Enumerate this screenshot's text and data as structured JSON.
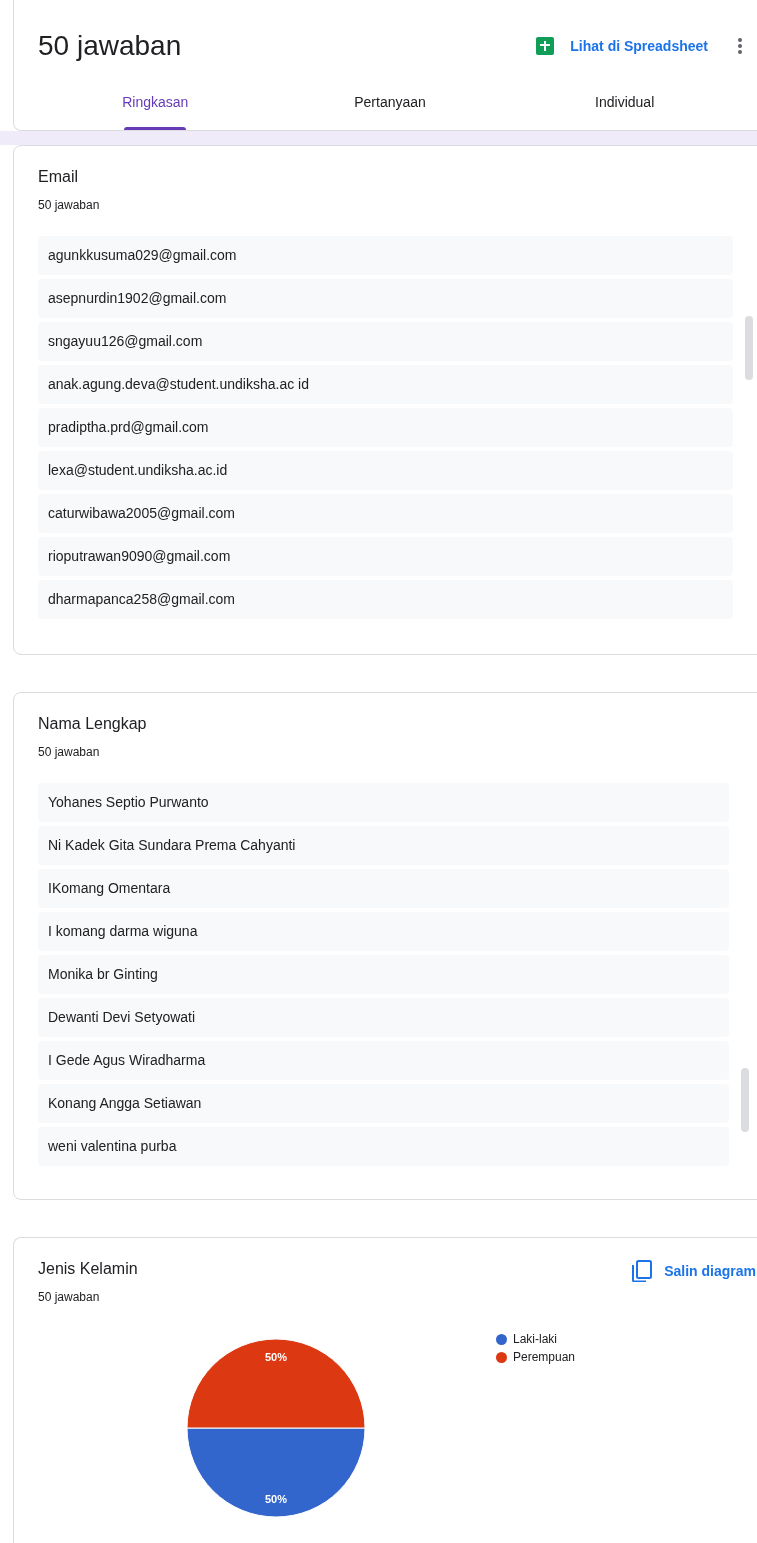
{
  "header": {
    "title": "50 jawaban",
    "sheet_link": "Lihat di Spreadsheet"
  },
  "tabs": [
    {
      "label": "Ringkasan",
      "selected": true
    },
    {
      "label": "Pertanyaan",
      "selected": false
    },
    {
      "label": "Individual",
      "selected": false
    }
  ],
  "questions": [
    {
      "kind": "list",
      "title": "Email",
      "count": "50 jawaban",
      "answers": [
        "agunkkusuma029@gmail.com",
        "asepnurdin1902@gmail.com",
        "sngayuu126@gmail.com",
        "anak.agung.deva@student.undiksha.ac id",
        "pradiptha.prd@gmail.com",
        "lexa@student.undiksha.ac.id",
        "caturwibawa2005@gmail.com",
        "rioputrawan9090@gmail.com",
        "dharmapanca258@gmail.com"
      ]
    },
    {
      "kind": "list",
      "title": "Nama Lengkap",
      "count": "50 jawaban",
      "answers": [
        "Yohanes Septio Purwanto",
        "Ni Kadek Gita Sundara Prema Cahyanti",
        "IKomang Omentara",
        "I komang darma wiguna",
        "Monika br Ginting",
        "Dewanti Devi Setyowati",
        "I Gede Agus Wiradharma",
        "Konang Angga Setiawan",
        "weni valentina purba"
      ]
    },
    {
      "kind": "pie",
      "title": "Jenis Kelamin",
      "count": "50 jawaban",
      "copy_label": "Salin diagram",
      "chart_data": {
        "type": "pie",
        "categories": [
          "Laki-laki",
          "Perempuan"
        ],
        "values": [
          50,
          50
        ],
        "value_labels": [
          "50%",
          "50%"
        ]
      },
      "legend": [
        {
          "color": "#3366cc"
        },
        {
          "color": "#dc3912"
        }
      ]
    }
  ]
}
